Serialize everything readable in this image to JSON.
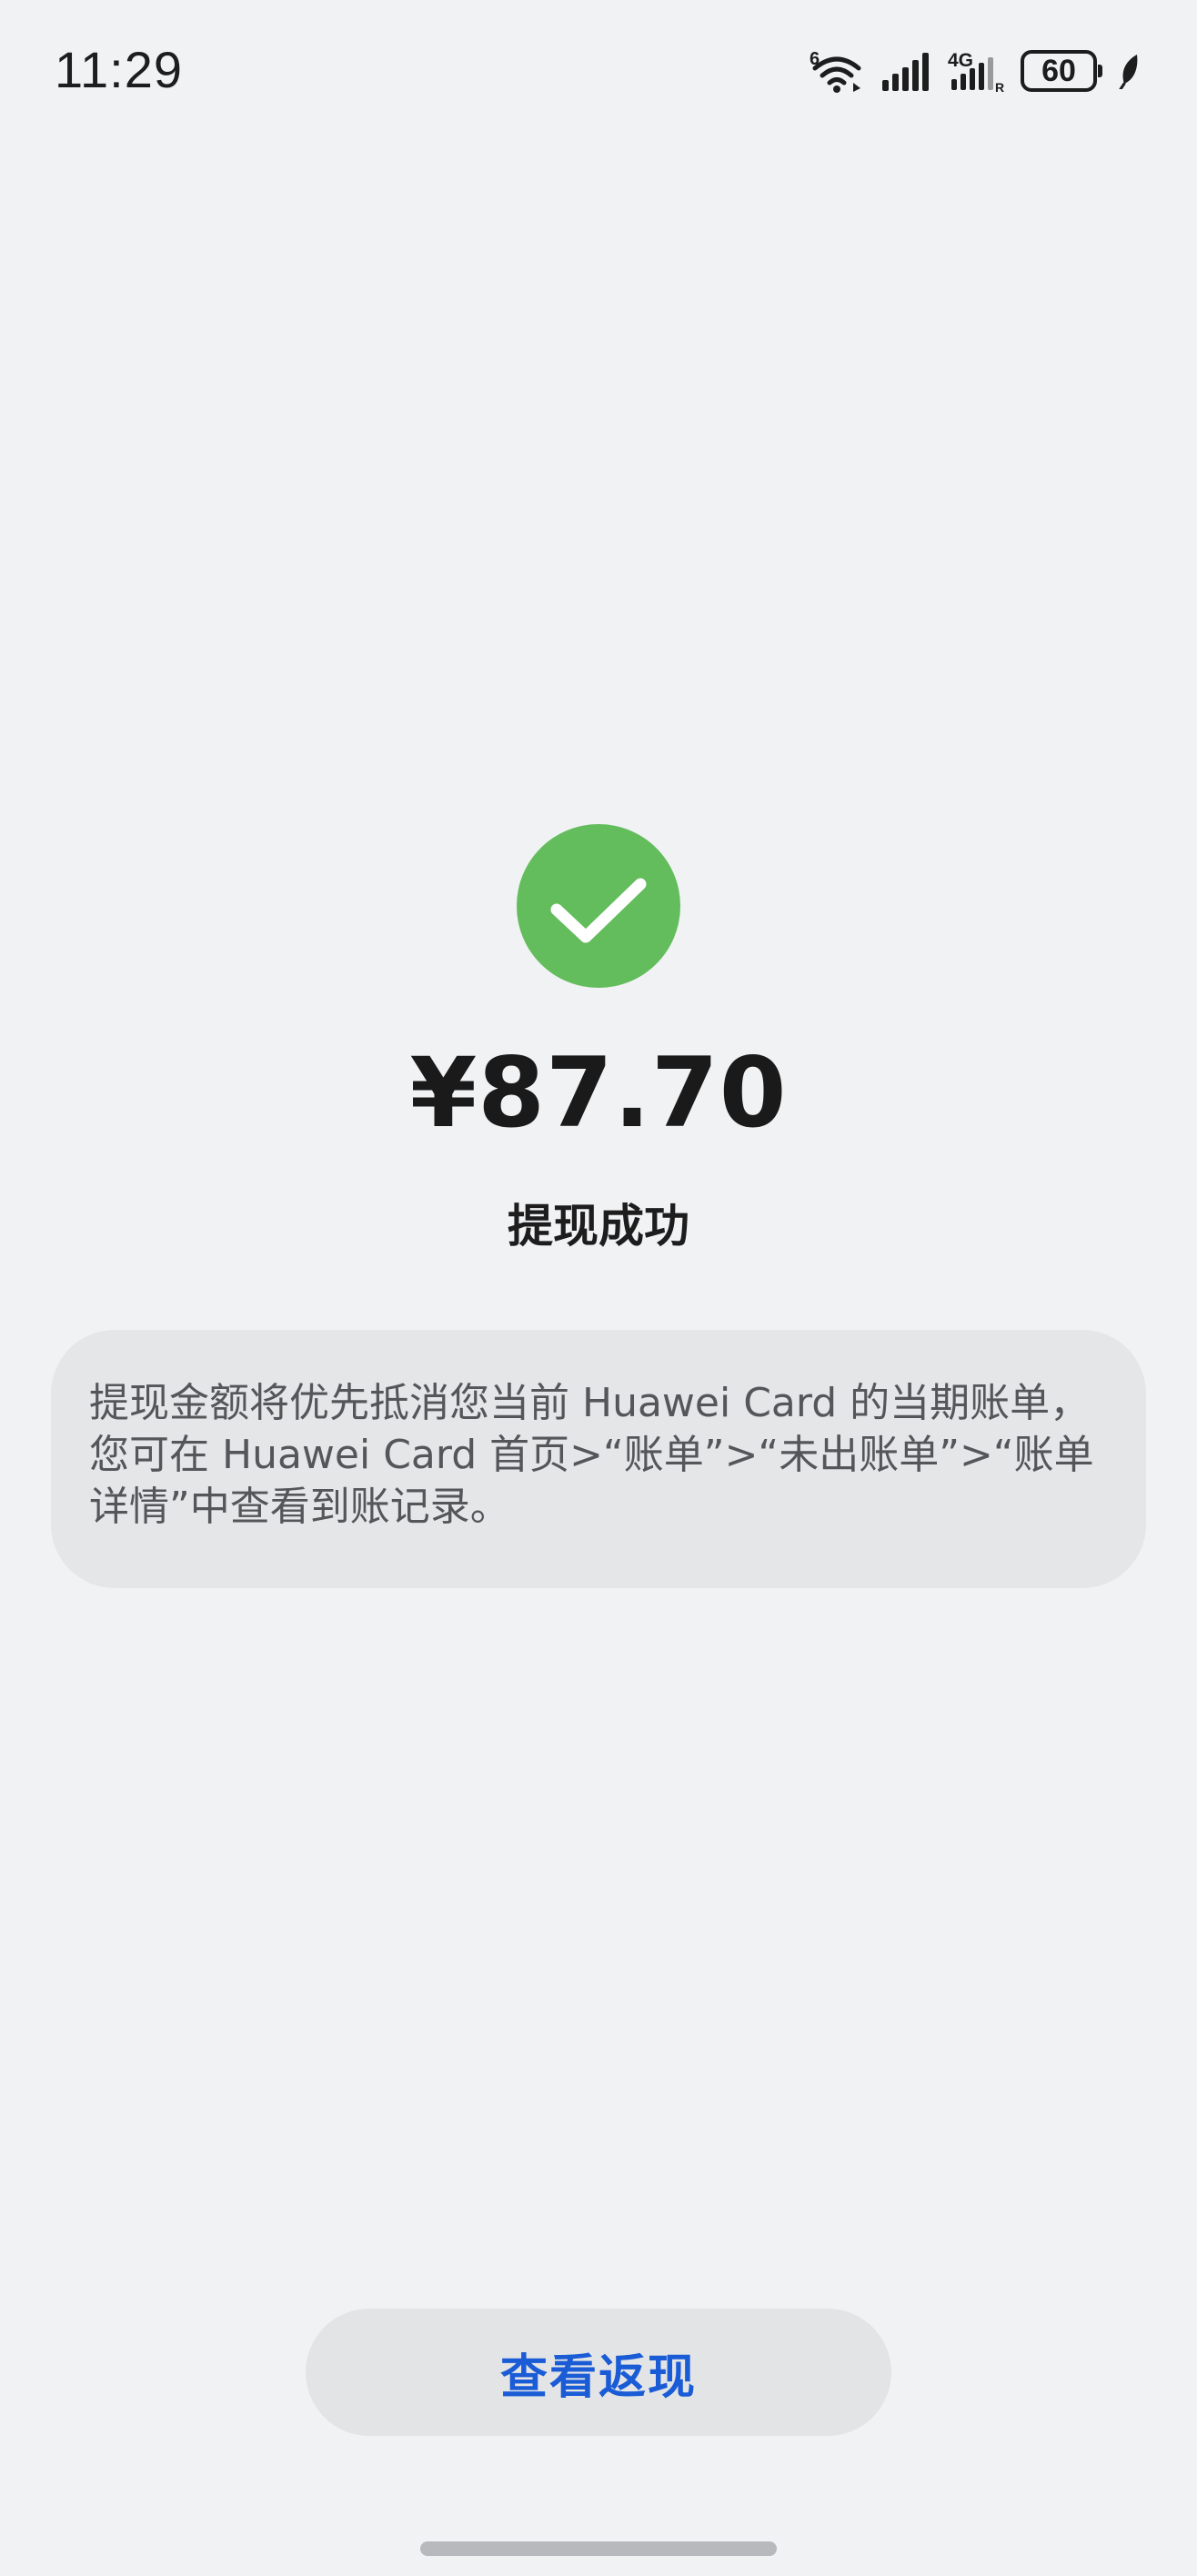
{
  "status_bar": {
    "time": "11:29",
    "wifi_label": "6",
    "network_label": "4G",
    "roaming_label": "R",
    "battery": "60",
    "icons": [
      "wifi-6-icon",
      "signal-icon",
      "4g-signal-icon",
      "battery-icon",
      "leaf-icon"
    ]
  },
  "result": {
    "icon": "check-circle-icon",
    "icon_color": "#63bd5c",
    "amount": "¥87.70",
    "title": "提现成功",
    "info": "提现金额将优先抵消您当前 Huawei Card 的当期账单，您可在 Huawei Card 首页>“账单”>“未出账单”>“账单详情”中查看到账记录。"
  },
  "actions": {
    "view_cashback_label": "查看返现",
    "accent_color": "#1a5bd6"
  }
}
